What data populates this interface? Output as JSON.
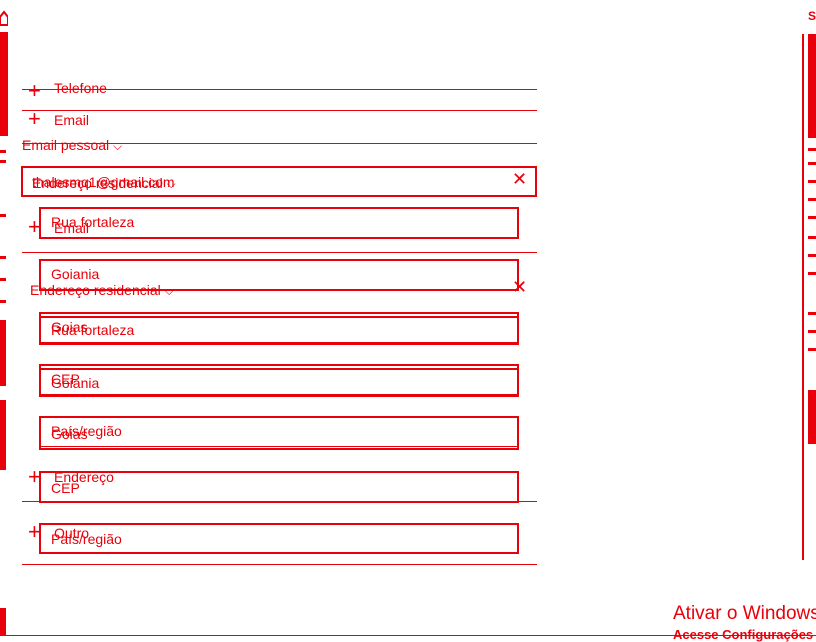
{
  "sections": {
    "phone_label": "Telefone",
    "email_add_label": "Email",
    "email_type": "Email pessoal",
    "email_value": "thalesmq1@gmail.com",
    "email_type_overlap": "Endereço residencial",
    "email_add_label_2": "Email",
    "address_type": "Endereço residencial",
    "street_1": "Rua fortaleza",
    "city_1": "Goiania",
    "state_1": "Goias",
    "street_2": "Rua fortaleza",
    "zip_1": "CEP",
    "city_2": "Goiania",
    "country_1": "País/região",
    "state_2": "Goias",
    "address_add_label": "Endereço",
    "zip_2": "CEP",
    "other_add_label": "Outro",
    "country_2": "País/região"
  },
  "right_panel": {
    "top_letter": "S"
  },
  "watermark": {
    "title": "Ativar o Windows",
    "subtitle": "Acesse Configurações"
  },
  "icons": {
    "plus": "+",
    "close": "✕",
    "chevron": "⌵"
  }
}
